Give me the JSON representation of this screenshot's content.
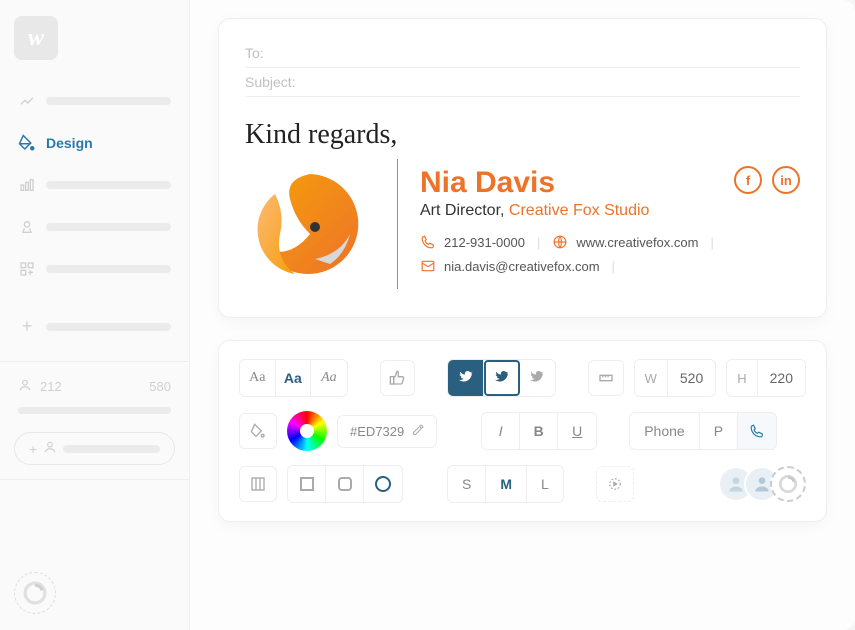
{
  "sidebar": {
    "active_label": "Design",
    "stat_left": "212",
    "stat_right": "580"
  },
  "compose": {
    "to_label": "To:",
    "subject_label": "Subject:"
  },
  "signature": {
    "greeting": "Kind regards,",
    "name": "Nia Davis",
    "role": "Art Director,",
    "company": "Creative Fox Studio",
    "phone": "212-931-0000",
    "website": "www.creativefox.com",
    "email": "nia.davis@creativefox.com"
  },
  "toolbar": {
    "width_label": "W",
    "width_value": "520",
    "height_label": "H",
    "height_value": "220",
    "color_hex": "#ED7329",
    "italic": "I",
    "bold": "B",
    "underline": "U",
    "phone_label": "Phone",
    "phone_short": "P",
    "size_s": "S",
    "size_m": "M",
    "size_l": "L"
  }
}
